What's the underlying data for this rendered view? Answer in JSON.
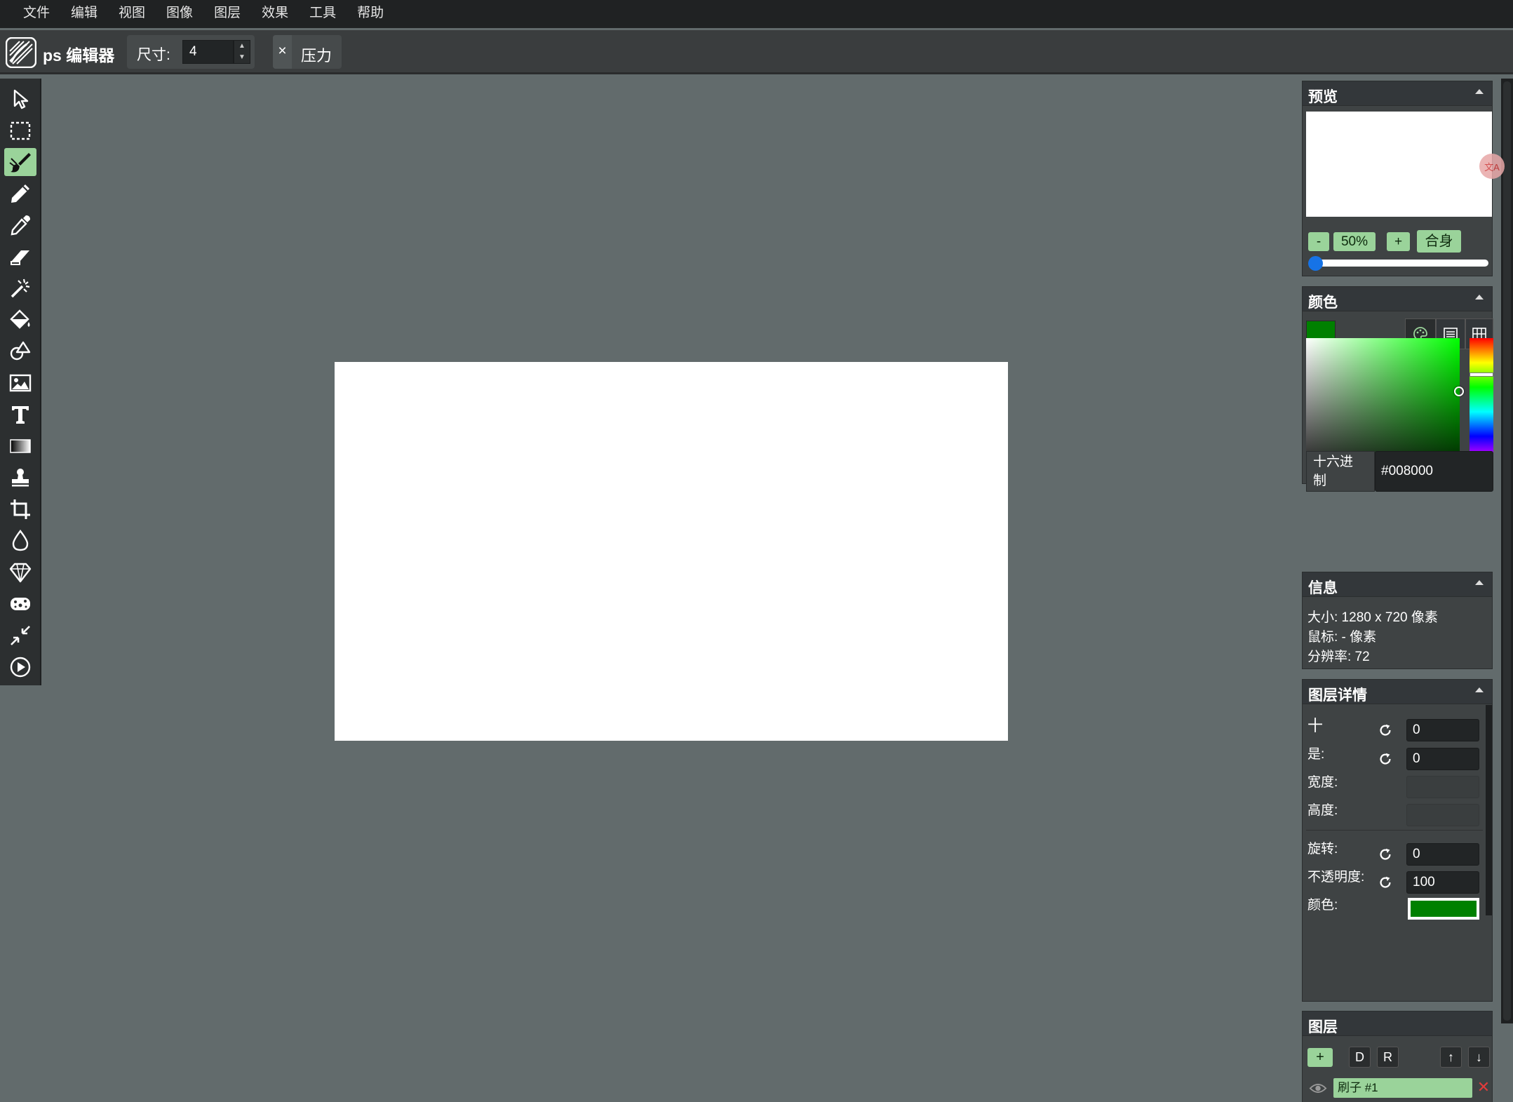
{
  "menu": [
    "文件",
    "编辑",
    "视图",
    "图像",
    "图层",
    "效果",
    "工具",
    "帮助"
  ],
  "toolbar": {
    "app_name": "ps 编辑器",
    "size_label": "尺寸:",
    "size_value": "4",
    "close_symbol": "×",
    "pressure_label": "压力"
  },
  "tools": [
    "select-arrow-icon",
    "marquee-select-icon",
    "brush-icon",
    "pencil-icon",
    "eyedropper-icon",
    "eraser-icon",
    "magic-wand-icon",
    "fill-bucket-icon",
    "shapes-icon",
    "image-icon",
    "text-icon",
    "gradient-icon",
    "clone-stamp-icon",
    "crop-icon",
    "blur-drop-icon",
    "sharpen-gem-icon",
    "sponge-icon",
    "resize-arrows-icon",
    "play-animation-icon"
  ],
  "active_tool": "brush-icon",
  "preview": {
    "title": "预览",
    "zoom_minus": "-",
    "zoom_value": "50%",
    "zoom_plus": "+",
    "fit_label": "合身",
    "zoom_slider_fraction": 0.0
  },
  "color_panel": {
    "title": "颜色",
    "current_color": "#008000",
    "hex_label": "十六进制",
    "hex_value": "#008000",
    "modes": [
      "palette-icon",
      "list-icon",
      "grid-icon"
    ]
  },
  "info": {
    "title": "信息",
    "size_line": "大小: 1280 x 720 像素",
    "mouse_line": "鼠标: - 像素",
    "resolution_line": "分辨率: 72"
  },
  "layer_details": {
    "title": "图层详情",
    "x_label": "十",
    "x_value": "0",
    "y_label": "是:",
    "y_value": "0",
    "width_label": "宽度:",
    "height_label": "高度:",
    "rotation_label": "旋转:",
    "rotation_value": "0",
    "opacity_label": "不透明度:",
    "opacity_value": "100",
    "color_label": "颜色:",
    "color_value": "#008000"
  },
  "layers": {
    "title": "图层",
    "add_label": "+",
    "duplicate_label": "D",
    "rasterize_label": "R",
    "up_label": "↑",
    "down_label": "↓",
    "items": [
      {
        "name": "刷子 #1",
        "visible": true
      }
    ],
    "delete_symbol": "✕"
  },
  "colors": {
    "accent_green": "#9ad39a",
    "selected_color": "#008000",
    "delete_red": "#e23b3b"
  }
}
